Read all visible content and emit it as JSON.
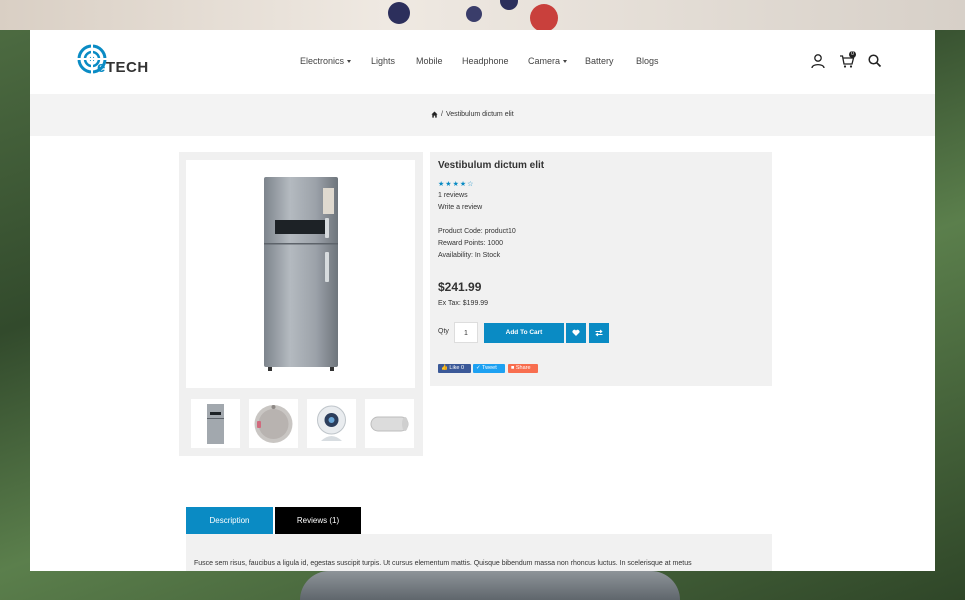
{
  "brand": {
    "logo_prefix": "e",
    "logo_suffix": "TECH",
    "accent": "#0a8bc4"
  },
  "nav": {
    "items": [
      {
        "label": "Electronics",
        "dropdown": true
      },
      {
        "label": "Lights",
        "dropdown": false
      },
      {
        "label": "Mobile",
        "dropdown": false
      },
      {
        "label": "Headphone",
        "dropdown": false
      },
      {
        "label": "Camera",
        "dropdown": true
      },
      {
        "label": "Battery",
        "dropdown": false
      },
      {
        "label": "Blogs",
        "dropdown": false
      }
    ],
    "icons": [
      "user-icon",
      "cart-icon",
      "search-icon"
    ],
    "cart_count": "0"
  },
  "breadcrumb": {
    "home_icon": "home-icon",
    "separator": "/",
    "current": "Vestibulum dictum elit"
  },
  "product": {
    "title": "Vestibulum dictum elit",
    "rating": 4,
    "rating_max": 5,
    "reviews": "1 reviews",
    "write_review": "Write a review",
    "code": "Product Code: product10",
    "reward": "Reward Points: 1000",
    "availability": "Availability: In Stock",
    "price": "$241.99",
    "ex_tax": "Ex Tax: $199.99",
    "qty_label": "Qty",
    "qty_value": "1",
    "add_to_cart": "Add To Cart",
    "wishlist_icon": "heart-icon",
    "compare_icon": "compare-icon"
  },
  "gallery": {
    "main": "refrigerator",
    "thumbs": [
      "refrigerator",
      "speaker-fabric",
      "webcam",
      "speaker-cylinder"
    ]
  },
  "social": {
    "like": "Like 0",
    "tweet": "Tweet",
    "share": "Share"
  },
  "tabs": [
    {
      "label": "Description",
      "active": true
    },
    {
      "label": "Reviews (1)",
      "active": false
    }
  ],
  "description": "Fusce sem risus, faucibus a ligula id, egestas suscipit turpis. Ut cursus elementum mattis. Quisque bibendum massa non rhoncus luctus. In scelerisque at metus"
}
